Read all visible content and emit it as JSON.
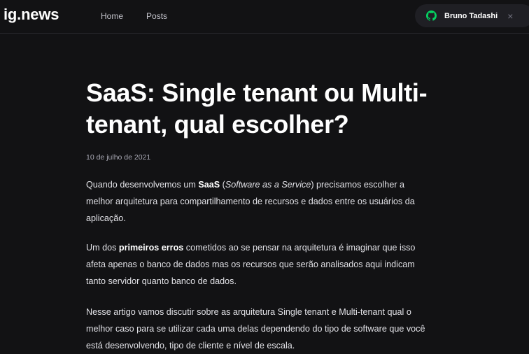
{
  "header": {
    "logo": "ig.news",
    "nav": [
      "Home",
      "Posts"
    ],
    "user": {
      "name": "Bruno Tadashi",
      "icon": "github-icon",
      "close_symbol": "×"
    }
  },
  "article": {
    "title": "SaaS: Single tenant ou Multi-tenant, qual escolher?",
    "date": "10 de julho de 2021",
    "paragraphs": [
      [
        {
          "t": "Quando desenvolvemos um "
        },
        {
          "t": "SaaS",
          "b": true
        },
        {
          "t": " ("
        },
        {
          "t": "Software as a Service",
          "i": true
        },
        {
          "t": ") precisamos escolher a melhor arquitetura para compartilhamento de recursos e dados entre os usuários da aplicação."
        }
      ],
      [
        {
          "t": "Um dos "
        },
        {
          "t": "primeiros erros",
          "b": true
        },
        {
          "t": " cometidos ao se pensar na arquitetura é imaginar que isso afeta apenas o banco de dados mas os recursos que serão analisados aqui indicam tanto servidor quanto banco de dados."
        }
      ],
      [
        {
          "t": "Nesse artigo vamos discutir sobre as arquitetura Single tenant e Multi-tenant qual o melhor caso para se utilizar cada uma delas dependendo do tipo de software que você está desenvolvendo, tipo de cliente e nível de escala."
        }
      ]
    ]
  },
  "colors": {
    "background": "#121214",
    "header_border": "#29292e",
    "pill_bg": "#1f1f24",
    "github_icon": "#04d361"
  }
}
